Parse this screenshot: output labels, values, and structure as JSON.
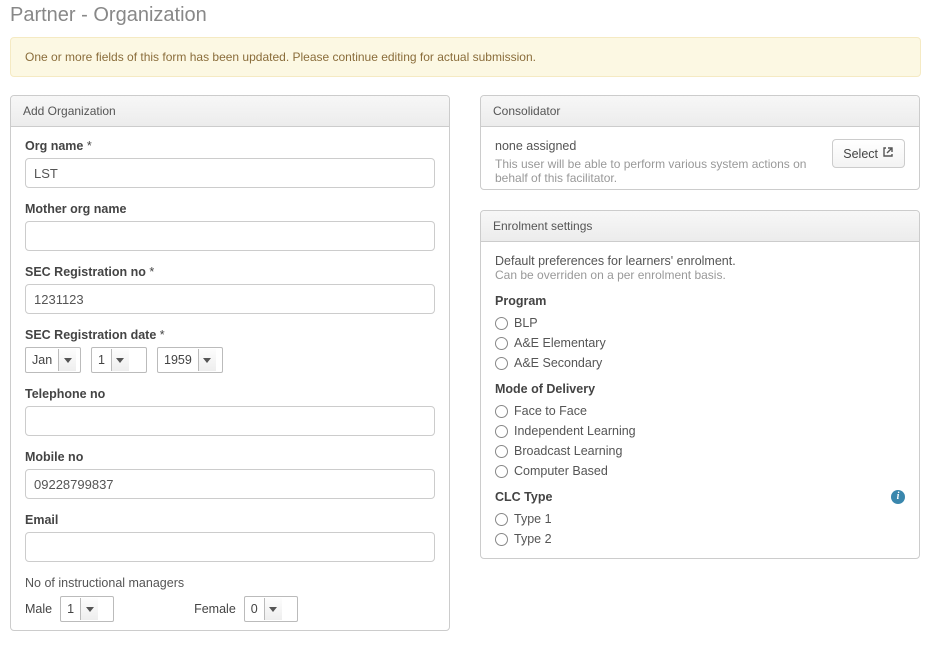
{
  "page_title": "Partner - Organization",
  "alert_text": "One or more fields of this form has been updated. Please continue editing for actual submission.",
  "left_panel": {
    "heading": "Add Organization",
    "org_name_label": "Org name",
    "org_name_value": "LST",
    "mother_org_label": "Mother org name",
    "mother_org_value": "",
    "sec_reg_no_label": "SEC Registration no",
    "sec_reg_no_value": "1231123",
    "sec_reg_date_label": "SEC Registration date",
    "sec_reg_date_month": "Jan",
    "sec_reg_date_day": "1",
    "sec_reg_date_year": "1959",
    "telephone_label": "Telephone no",
    "telephone_value": "",
    "mobile_label": "Mobile no",
    "mobile_value": "09228799837",
    "email_label": "Email",
    "email_value": "",
    "num_managers_label": "No of instructional managers",
    "male_label": "Male",
    "male_value": "1",
    "female_label": "Female",
    "female_value": "0"
  },
  "consolidator": {
    "heading": "Consolidator",
    "select_btn": "Select",
    "none_text": "none assigned",
    "help_text": "This user will be able to perform various system actions on behalf of this facilitator."
  },
  "enrolment": {
    "heading": "Enrolment settings",
    "intro1": "Default preferences for learners' enrolment.",
    "intro2": "Can be overriden on a per enrolment basis.",
    "program_label": "Program",
    "programs": [
      "BLP",
      "A&E Elementary",
      "A&E Secondary"
    ],
    "mode_label": "Mode of Delivery",
    "modes": [
      "Face to Face",
      "Independent Learning",
      "Broadcast Learning",
      "Computer Based"
    ],
    "clc_label": "CLC Type",
    "clc_types": [
      "Type 1",
      "Type 2"
    ]
  }
}
